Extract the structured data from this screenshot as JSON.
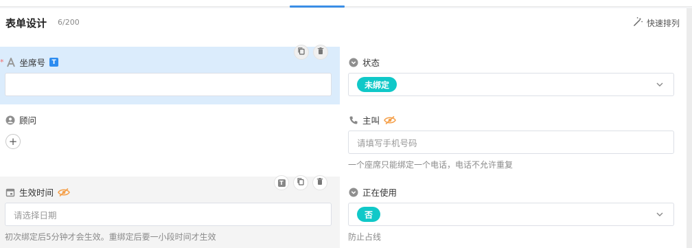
{
  "header": {
    "title": "表单设计",
    "count": "6/200",
    "quick_sort_label": "快速排列"
  },
  "fields": {
    "seat_no": {
      "required_mark": "*",
      "label": "坐席号",
      "badge": "T",
      "value": ""
    },
    "status": {
      "label": "状态",
      "selected": "未绑定"
    },
    "advisor": {
      "label": "顾问",
      "add": "+"
    },
    "main_call": {
      "label": "主叫",
      "placeholder": "请填写手机号码",
      "hint": "一个座席只能绑定一个电话，电话不允许重复"
    },
    "effective_time": {
      "label": "生效时间",
      "placeholder": "请选择日期",
      "hint": "初次绑定后5分钟才会生效。重绑定后要一小段时间才生效"
    },
    "in_use": {
      "label": "正在使用",
      "selected": "否",
      "hint": "防止占线"
    },
    "hover_toolbar_badge": "T"
  },
  "colors": {
    "accent": "#2d8cf0",
    "tag": "#10c8c8",
    "selected_bg": "#dbecfc",
    "hidden_icon": "#f5a04a",
    "required": "#f56c6c"
  }
}
